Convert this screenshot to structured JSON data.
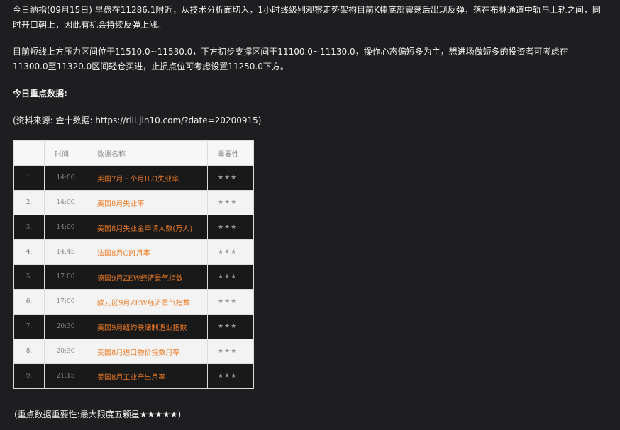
{
  "paragraphs": {
    "p1": "今日納指(09月15日) 早盘在11286.1附近，从技术分析面切入，1小时线级别观察走势架构目前K棒底部震荡后出现反弹，落在布林通道中轨与上轨之间，同时开口朝上，因此有机会持续反弹上涨。",
    "p2": "目前短线上方压力区间位于11510.0~11530.0，下方初步支撑区间于11100.0~11130.0，操作心态偏短多为主，想进场做短多的投资者可考虑在11300.0至11320.0区间轻仓买进，止损点位可考虑设置11250.0下方。"
  },
  "heading": "今日重点数据:",
  "source": "(资料来源: 金十数据: https://rili.jin10.com/?date=20200915)",
  "table": {
    "headers": {
      "index": "",
      "time": "时间",
      "name": "数据名称",
      "importance": "重要性"
    },
    "rows": [
      {
        "index": "1.",
        "time": "14:00",
        "name": "美国7月三个月ILO失业率",
        "importance": "★★★"
      },
      {
        "index": "2.",
        "time": "14:00",
        "name": "美国8月失业率",
        "importance": "★★★"
      },
      {
        "index": "3.",
        "time": "14:00",
        "name": "美国8月失业金申请人数(万人)",
        "importance": "★★★"
      },
      {
        "index": "4.",
        "time": "14:45",
        "name": "法国8月CPI月率",
        "importance": "★★★"
      },
      {
        "index": "5.",
        "time": "17:00",
        "name": "德国9月ZEW经济景气指数",
        "importance": "★★★"
      },
      {
        "index": "6.",
        "time": "17:00",
        "name": "欧元区9月ZEW经济景气指数",
        "importance": "★★★"
      },
      {
        "index": "7.",
        "time": "20:30",
        "name": "美国9月纽约联储制造业指数",
        "importance": "★★★"
      },
      {
        "index": "8.",
        "time": "20:30",
        "name": "美国8月进口物价指数月率",
        "importance": "★★★"
      },
      {
        "index": "9.",
        "time": "21:15",
        "name": "美国8月工业产出月率",
        "importance": "★★★"
      }
    ]
  },
  "footnote": "(重点数据重要性:最大限度五颗星★★★★★)",
  "colors": {
    "background": "#1e1e21",
    "accent": "#ef7b25"
  }
}
